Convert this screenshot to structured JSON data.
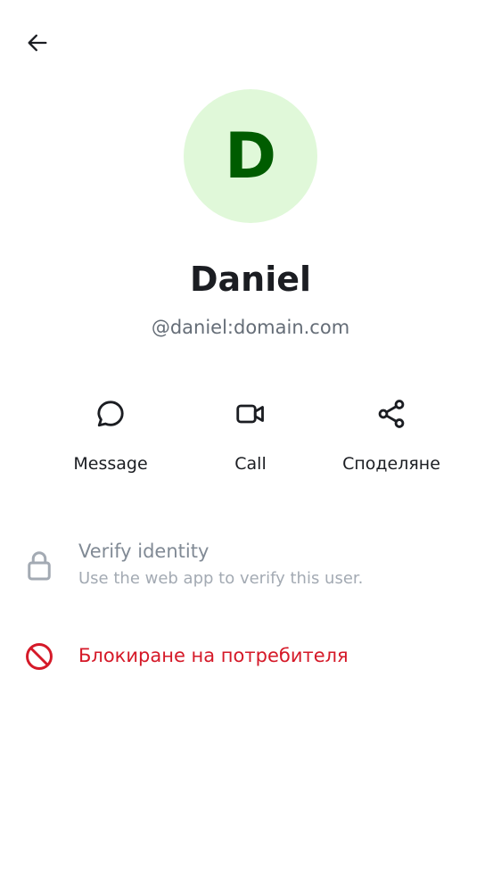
{
  "header": {
    "back_icon": "arrow-left-icon"
  },
  "profile": {
    "avatar_letter": "D",
    "avatar_bg": "#e0f8d9",
    "avatar_fg": "#005c00",
    "display_name": "Daniel",
    "user_id": "@daniel:domain.com"
  },
  "actions": [
    {
      "label": "Message",
      "icon": "chat-bubble-icon"
    },
    {
      "label": "Call",
      "icon": "video-camera-icon"
    },
    {
      "label": "Споделяне",
      "icon": "share-icon"
    }
  ],
  "verify": {
    "title": "Verify identity",
    "subtitle": "Use the web app to verify this user.",
    "icon": "lock-icon"
  },
  "block": {
    "label": "Блокиране на потребителя",
    "icon": "block-icon",
    "color": "#d51928"
  }
}
